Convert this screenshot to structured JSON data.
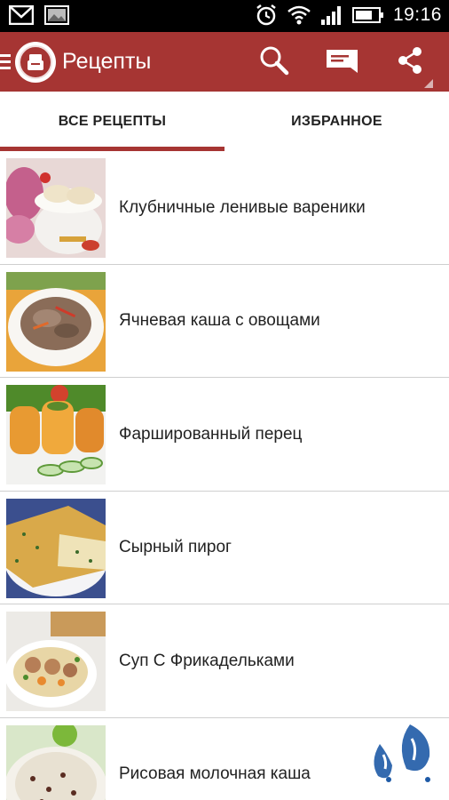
{
  "status_bar": {
    "time": "19:16",
    "left_icons": [
      "gmail-icon",
      "gallery-icon"
    ],
    "right_icons": [
      "alarm-icon",
      "wifi-icon",
      "signal-icon",
      "battery-icon"
    ]
  },
  "action_bar": {
    "title": "Рецепты",
    "icons": [
      "search-icon",
      "message-icon",
      "share-icon"
    ],
    "color": "#a63533"
  },
  "tabs": [
    {
      "label": "ВСЕ РЕЦЕПТЫ",
      "active": true
    },
    {
      "label": "ИЗБРАННОЕ",
      "active": false
    }
  ],
  "recipes": [
    {
      "title": "Клубничные ленивые вареники"
    },
    {
      "title": "Ячневая каша с овощами"
    },
    {
      "title": "Фаршированный перец"
    },
    {
      "title": "Сырный пирог"
    },
    {
      "title": "Суп С Фрикадельками"
    },
    {
      "title": "Рисовая молочная каша"
    }
  ]
}
